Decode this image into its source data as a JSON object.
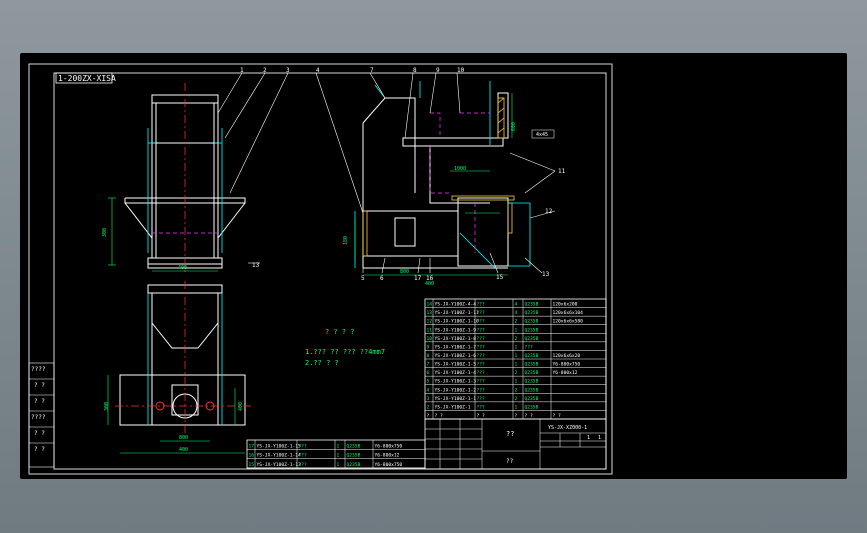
{
  "colors": {
    "background": "#000000",
    "frame": "#d8d8d8",
    "line": "#ffffff",
    "cad_cyan": "#00ffff",
    "centerline": "#ff3333",
    "hidden": "#ff33ff",
    "hatch": "#ffcc33",
    "dimension": "#00ff66"
  },
  "title_tag": "1-200ZX-XISA",
  "callouts": [
    "1",
    "2",
    "3",
    "4",
    "7",
    "8",
    "9",
    "10",
    "11",
    "12",
    "13",
    "14",
    "15",
    "16",
    "17",
    "5",
    "6"
  ],
  "dims": {
    "top_right_a": "4x45",
    "width_a": "400",
    "width_b": "800",
    "width_c": "1000",
    "height_a": "300",
    "mid_a": "180",
    "mid_b": "600",
    "bottom_a": "400",
    "right_a": "400"
  },
  "notes": {
    "heading": "? ? ? ?",
    "line1": "1.??? ?? ??? ??4mm7",
    "line2": "2.?? ? ?"
  },
  "bom_rows": [
    {
      "no": "14",
      "code": "YS-JX-Y100Z-4-4",
      "name": "???",
      "qty": "4",
      "mat": "Q235B",
      "spec": "120x6x200"
    },
    {
      "no": "13",
      "code": "YS-JX-Y100Z-1-11",
      "name": "???",
      "qty": "4",
      "mat": "Q235B",
      "spec": "120x6x6x104"
    },
    {
      "no": "12",
      "code": "YS-JX-Y100Z-1-10",
      "name": "???",
      "qty": "2",
      "mat": "Q235B",
      "spec": "120x6x6x580"
    },
    {
      "no": "11",
      "code": "YS-JX-Y100Z-1-9",
      "name": "???",
      "qty": "1",
      "mat": "Q235B",
      "spec": ""
    },
    {
      "no": "10",
      "code": "YS-JX-Y100Z-1-8",
      "name": "???",
      "qty": "2",
      "mat": "Q235B",
      "spec": ""
    },
    {
      "no": "9",
      "code": "YS-JX-Y100Z-1-7",
      "name": "???",
      "qty": "1",
      "mat": "???",
      "spec": ""
    },
    {
      "no": "8",
      "code": "YS-JX-Y100Z-1-6",
      "name": "???",
      "qty": "1",
      "mat": "Q235B",
      "spec": "120x6x6x20"
    },
    {
      "no": "7",
      "code": "YS-JX-Y100Z-1-5",
      "name": "???",
      "qty": "1",
      "mat": "Q235B",
      "spec": "Y6-800x750"
    },
    {
      "no": "6",
      "code": "YS-JX-Y100Z-1-4",
      "name": "???",
      "qty": "2",
      "mat": "Q235B",
      "spec": "Y6-800x12"
    },
    {
      "no": "5",
      "code": "YS-JX-Y100Z-1-3",
      "name": "???",
      "qty": "1",
      "mat": "Q235B",
      "spec": ""
    },
    {
      "no": "4",
      "code": "YS-JX-Y100Z-1-2",
      "name": "???",
      "qty": "2",
      "mat": "Q235B",
      "spec": ""
    },
    {
      "no": "3",
      "code": "YS-JX-Y100Z-1-1",
      "name": "???",
      "qty": "2",
      "mat": "Q235B",
      "spec": ""
    },
    {
      "no": "2",
      "code": "YS-JX-Y100Z-1",
      "name": "???",
      "qty": "1",
      "mat": "Q235B",
      "spec": ""
    }
  ],
  "bom_header": {
    "no": "?",
    "code": "? ?",
    "name": "? ?",
    "qty": "?",
    "mat": "? ?",
    "spec": "? ?"
  },
  "bottom_bom_rows": [
    {
      "no": "17",
      "code": "YS-JX-Y100Z-1-15",
      "name": "???",
      "qty": "1",
      "mat": "Q235B",
      "spec": "Y6-800x750"
    },
    {
      "no": "16",
      "code": "YS-JX-Y100Z-1-14",
      "name": "???",
      "qty": "1",
      "mat": "Q235B",
      "spec": "Y6-800x12"
    },
    {
      "no": "15",
      "code": "YS-JX-Y100Z-1-13",
      "name": "???",
      "qty": "1",
      "mat": "Q235B",
      "spec": "Y6-800x750"
    }
  ],
  "title_block": {
    "part_title": "??",
    "drawing_no": "YS-JX-XZ000-1",
    "company": "??",
    "scale": "1",
    "sheet": "1"
  },
  "left_margin_labels": [
    "????",
    "? ?",
    "? ?",
    "????",
    "? ?",
    "? ?"
  ]
}
